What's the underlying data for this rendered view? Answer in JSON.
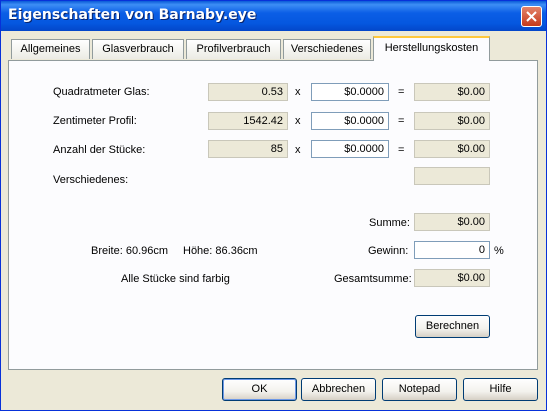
{
  "window": {
    "title": "Eigenschaften von Barnaby.eye"
  },
  "tabs": [
    {
      "label": "Allgemeines"
    },
    {
      "label": "Glasverbrauch"
    },
    {
      "label": "Profilverbrauch"
    },
    {
      "label": "Verschiedenes"
    },
    {
      "label": "Herstellungskosten"
    }
  ],
  "rows": [
    {
      "label": "Quadratmeter Glas:",
      "quantity": "0.53",
      "price": "$0.0000",
      "total": "$0.00"
    },
    {
      "label": "Zentimeter Profil:",
      "quantity": "1542.42",
      "price": "$0.0000",
      "total": "$0.00"
    },
    {
      "label": "Anzahl der Stücke:",
      "quantity": "85",
      "price": "$0.0000",
      "total": "$0.00"
    }
  ],
  "operators": {
    "times": "x",
    "equals": "="
  },
  "misc": {
    "label": "Verschiedenes:",
    "value": ""
  },
  "summary": {
    "summe_label": "Summe:",
    "summe_value": "$0.00",
    "gewinn_label": "Gewinn:",
    "gewinn_value": "0",
    "gewinn_unit": "%",
    "gesamt_label": "Gesamtsumme:",
    "gesamt_value": "$0.00"
  },
  "dimensions": {
    "breite": "Breite: 60.96cm",
    "hoehe": "Höhe: 86.36cm"
  },
  "note": "Alle Stücke sind farbig",
  "buttons": {
    "berechnen": "Berechnen",
    "ok": "OK",
    "abbrechen": "Abbrechen",
    "notepad": "Notepad",
    "hilfe": "Hilfe"
  }
}
